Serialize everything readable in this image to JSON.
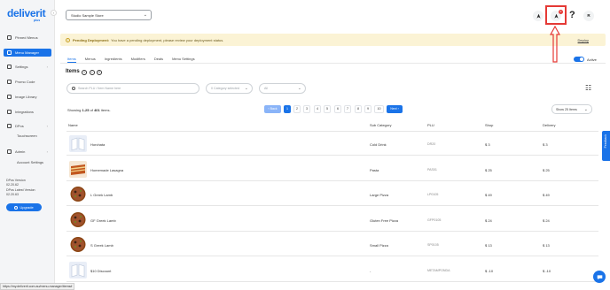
{
  "brand": {
    "name": "deliverit",
    "sub": "plus"
  },
  "sidebar": {
    "items": [
      {
        "label": "Pinned Menus",
        "active": false
      },
      {
        "label": "Menu Manager",
        "active": true
      },
      {
        "label": "Settings",
        "active": false,
        "caret": "›"
      },
      {
        "label": "Promo Code",
        "active": false
      },
      {
        "label": "Image Library",
        "active": false
      },
      {
        "label": "Integrations",
        "active": false
      },
      {
        "label": "DPos",
        "active": false,
        "caret": "›"
      },
      {
        "label": "Admin",
        "active": false,
        "caret": "›"
      }
    ],
    "subitems": [
      "Touchscreen",
      "Account Settings"
    ],
    "version_lines": [
      "DPos Version",
      "02.20.62",
      "DPos Latest Version",
      "02.20.63"
    ],
    "upgrade_label": "Upgrade"
  },
  "topbar": {
    "store": "Studio Sample Store",
    "avatar_letter": "R",
    "help": "?",
    "badge": "0"
  },
  "banner": {
    "title": "Pending Deployment:",
    "message": "You have a pending deployment, please review your deployment status.",
    "link": "Deploy"
  },
  "tabs": [
    "Items",
    "Menus",
    "Ingredients",
    "Modifiers",
    "Deals",
    "Menu Settings"
  ],
  "active_toggle_label": "Active",
  "items_title": "Items",
  "title_buttons": [
    "+",
    "i",
    "≡"
  ],
  "filters": {
    "search_placeholder": "Search PLU / Item Name here",
    "category_placeholder": "0 Category selected",
    "all_placeholder": "All"
  },
  "pagination": {
    "showing_prefix": "Showing",
    "showing_range": "1-25",
    "showing_of": "of",
    "showing_total": "401",
    "showing_suffix": "items.",
    "prev": "‹ Back",
    "pages": [
      "1",
      "2",
      "3",
      "4",
      "5",
      "6",
      "7",
      "8",
      "9",
      "10"
    ],
    "next": "Next ›",
    "per_page": "Show 25 Items"
  },
  "table": {
    "headers": [
      "Name",
      "Sub Category",
      "PLU",
      "Shop",
      "Delivery"
    ],
    "rows": [
      {
        "name": "Horchata",
        "sub": "Cold Drink",
        "plu": "DR20",
        "shop": "$ 3",
        "delivery": "$ 3",
        "img": "book"
      },
      {
        "name": "Homemade Lasagna",
        "sub": "Pasta",
        "plu": "PAS01",
        "shop": "$ 25",
        "delivery": "$ 25",
        "img": "lasagna"
      },
      {
        "name": "L Greek Lamb",
        "sub": "Large Pizza",
        "plu": "LP0105",
        "shop": "$ 49",
        "delivery": "$ 49",
        "img": "pizza"
      },
      {
        "name": "GF Greek Lamb",
        "sub": "Gluten Free Pizza",
        "plu": "GFP0105",
        "shop": "$ 24",
        "delivery": "$ 24",
        "img": "pizza"
      },
      {
        "name": "S Greek Lamb",
        "sub": "Small Pizza",
        "plu": "SP0105",
        "shop": "$ 13",
        "delivery": "$ 13",
        "img": "pizza"
      },
      {
        "name": "$10 Discount",
        "sub": "-",
        "plu": "METAMPONDA",
        "shop": "$ -10",
        "delivery": "$ -10",
        "img": "book"
      }
    ]
  },
  "feedback_label": "Feedback",
  "status_url": "https://my.deliverit.com.au/menu-manager/items#",
  "colors": {
    "accent": "#1a73e8",
    "highlight": "#e53935",
    "banner": "#fbf3d5"
  }
}
